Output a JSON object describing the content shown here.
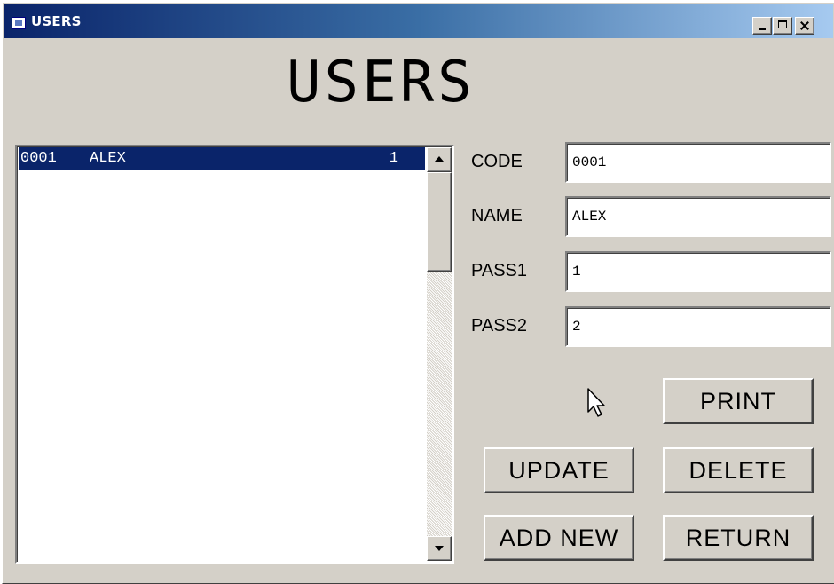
{
  "window": {
    "title": "USERS",
    "controls": {
      "minimize": "minimize-icon",
      "maximize": "maximize-icon",
      "close": "close-icon"
    }
  },
  "form": {
    "heading": "USERS"
  },
  "list": {
    "rows": [
      {
        "code": "0001",
        "name": "ALEX",
        "pass": "1",
        "selected": true
      }
    ]
  },
  "fields": {
    "code": {
      "label": "CODE",
      "value": "0001"
    },
    "name": {
      "label": "NAME",
      "value": "ALEX"
    },
    "pass1": {
      "label": "PASS1",
      "value": "1"
    },
    "pass2": {
      "label": "PASS2",
      "value": "2"
    }
  },
  "buttons": {
    "print": "PRINT",
    "update": "UPDATE",
    "delete": "DELETE",
    "add_new": "ADD NEW",
    "return": "RETURN"
  },
  "colors": {
    "face": "#d4d0c8",
    "selection": "#0a246a",
    "title_gradient_start": "#0a246a",
    "title_gradient_end": "#a6caf0"
  }
}
